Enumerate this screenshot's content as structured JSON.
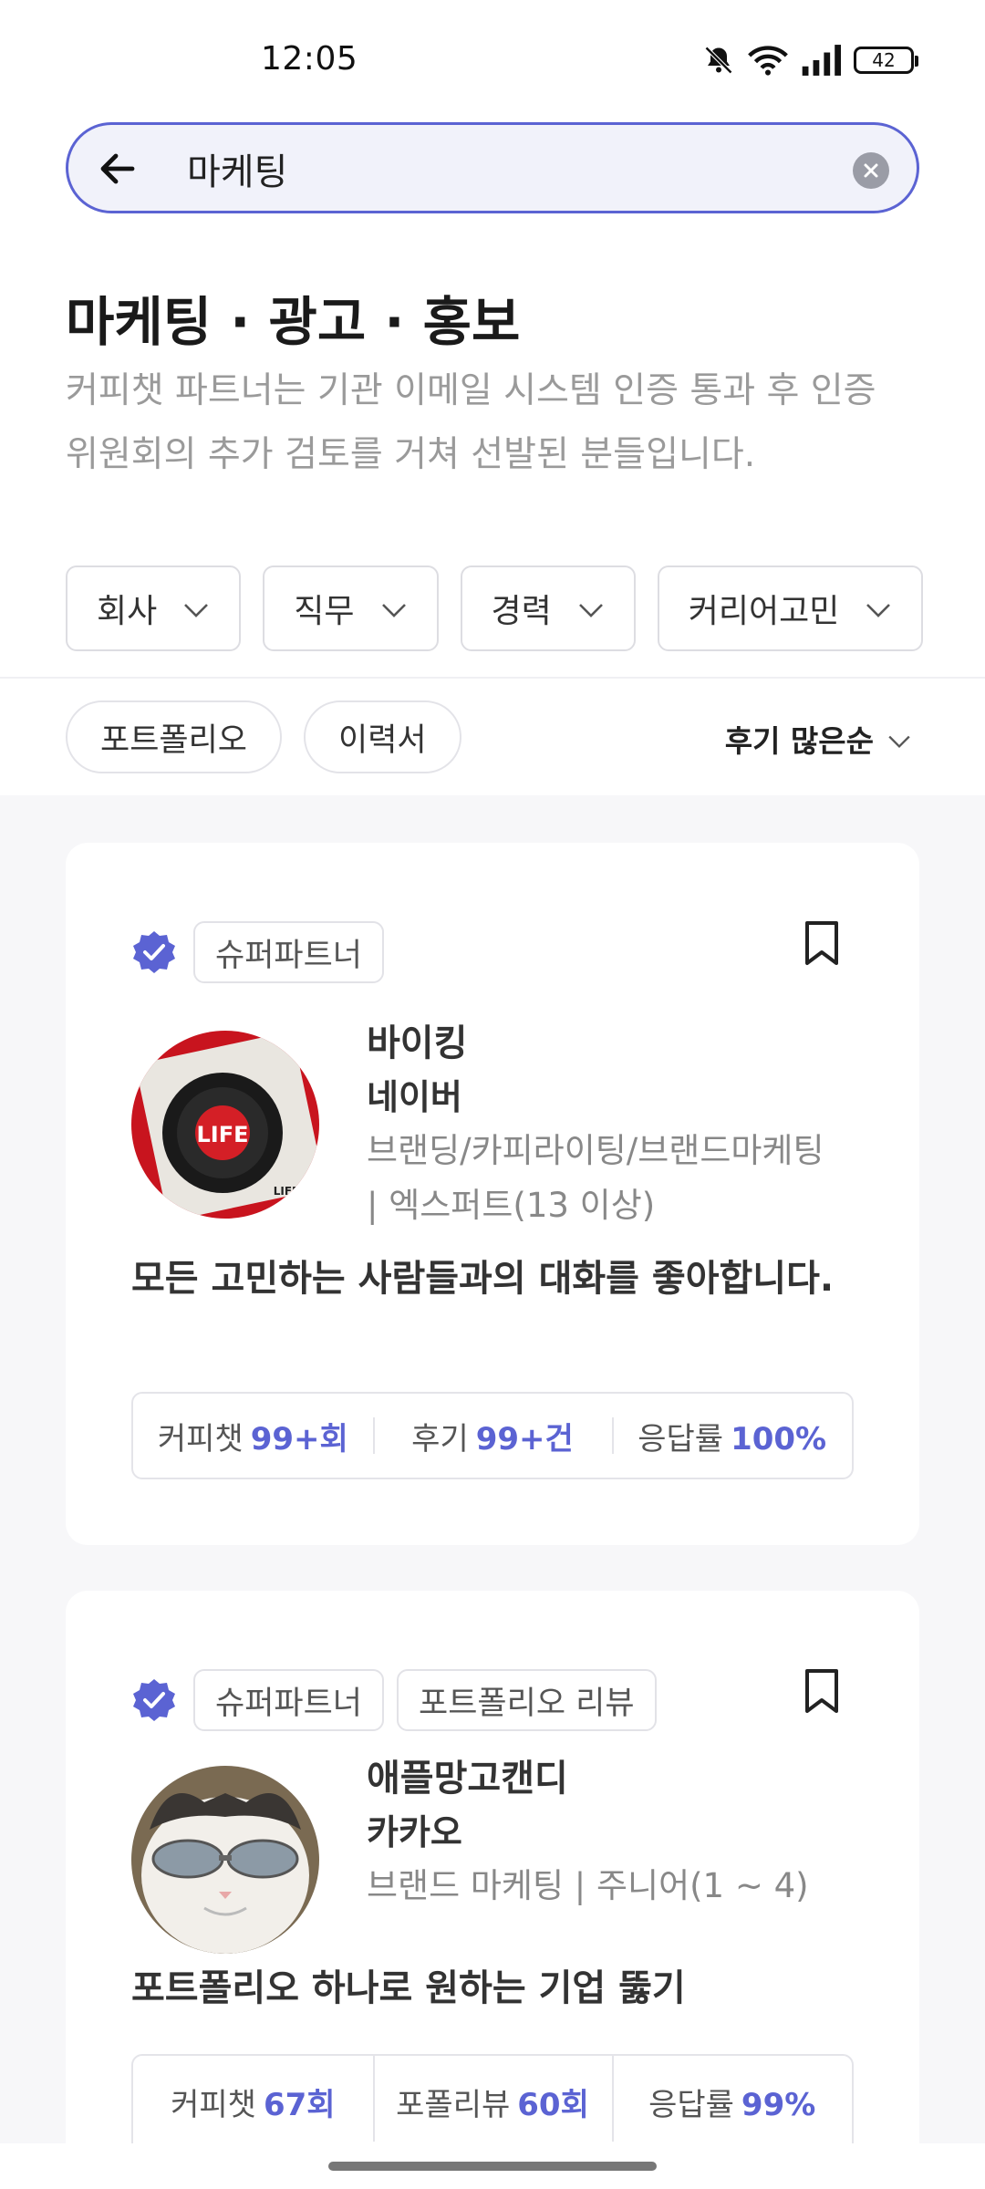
{
  "status_bar": {
    "time": "12:05",
    "battery": "42"
  },
  "search": {
    "value": "마케팅"
  },
  "category": {
    "title": "마케팅 · 광고 · 홍보",
    "description": "커피챗 파트너는 기관 이메일 시스템 인증 통과 후 인증 위원회의 추가 검토를 거쳐 선발된 분들입니다."
  },
  "filters": [
    {
      "label": "회사"
    },
    {
      "label": "직무"
    },
    {
      "label": "경력"
    },
    {
      "label": "커리어고민"
    }
  ],
  "tags": [
    {
      "label": "포트폴리오"
    },
    {
      "label": "이력서"
    }
  ],
  "sort": {
    "label": "후기 많은순"
  },
  "colors": {
    "accent": "#5b63d3",
    "muted": "#9a9a9a"
  },
  "partners": [
    {
      "badges": [
        "슈퍼파트너"
      ],
      "nickname": "바이킹",
      "company": "네이버",
      "role": "브랜딩/카피라이팅/브랜드마케팅 | 엑스퍼트(13 이상)",
      "headline": "모든 고민하는 사람들과의 대화를 좋아합니다.",
      "stats": [
        {
          "label": "커피챗",
          "value": "99+회"
        },
        {
          "label": "후기",
          "value": "99+건"
        },
        {
          "label": "응답률",
          "value": "100%"
        }
      ]
    },
    {
      "badges": [
        "슈퍼파트너",
        "포트폴리오 리뷰"
      ],
      "nickname": "애플망고캔디",
      "company": "카카오",
      "role": "브랜드 마케팅 | 주니어(1 ~ 4)",
      "headline": "포트폴리오 하나로 원하는 기업 뚫기",
      "stats": [
        {
          "label": "커피챗",
          "value": "67회"
        },
        {
          "label": "포폴리뷰",
          "value": "60회"
        },
        {
          "label": "응답률",
          "value": "99%"
        }
      ]
    }
  ]
}
